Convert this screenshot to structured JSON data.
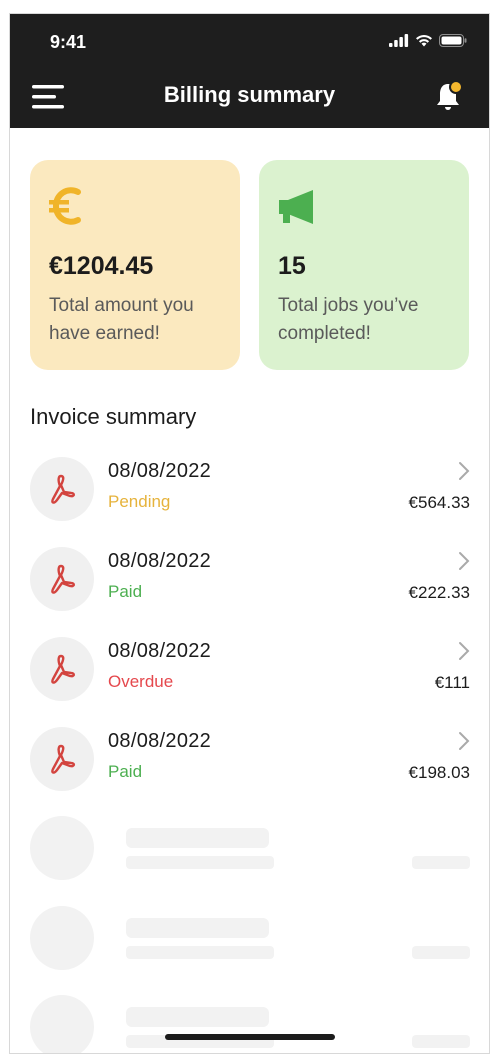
{
  "status_bar": {
    "time": "9:41"
  },
  "app_bar": {
    "title": "Billing summary",
    "menu_icon": "hamburger-menu-icon",
    "bell_icon": "notification-bell-icon"
  },
  "stats": [
    {
      "icon": "euro-icon",
      "value": "€1204.45",
      "label": "Total amount you have earned!",
      "bg_color": "#fbe9bf",
      "icon_color": "#f0b429"
    },
    {
      "icon": "megaphone-icon",
      "value": "15",
      "label": "Total jobs you’ve completed!",
      "bg_color": "#dbf2cf",
      "icon_color": "#4caf50"
    }
  ],
  "invoice_section": {
    "title": "Invoice summary",
    "items": [
      {
        "date": "08/08/2022",
        "status": "Pending",
        "amount": "€564.33",
        "status_color": "#e6b33c"
      },
      {
        "date": "08/08/2022",
        "status": "Paid",
        "amount": "€222.33",
        "status_color": "#4caf50"
      },
      {
        "date": "08/08/2022",
        "status": "Overdue",
        "amount": "€111",
        "status_color": "#e5484d"
      },
      {
        "date": "08/08/2022",
        "status": "Paid",
        "amount": "€198.03",
        "status_color": "#4caf50"
      }
    ]
  },
  "colors": {
    "app_bar_bg": "#1e1e1e",
    "pdf_icon": "#d3443f",
    "notification_dot": "#f5b82e"
  }
}
